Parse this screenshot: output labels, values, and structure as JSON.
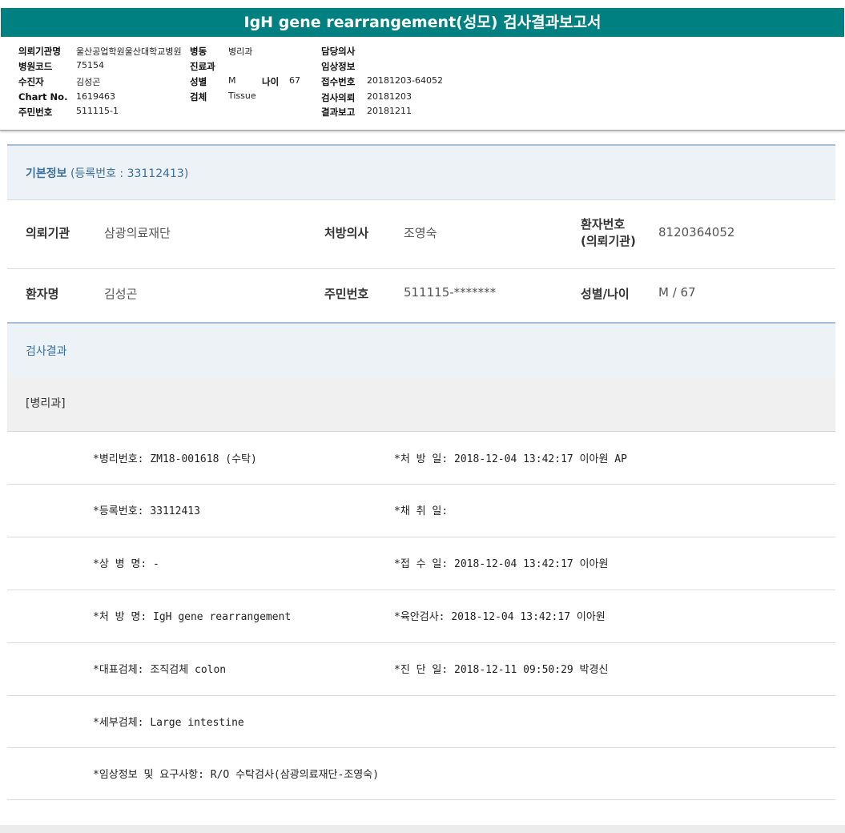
{
  "report_title": "IgH gene rearrangement(성모) 검사결과보고서",
  "header": {
    "left": [
      {
        "label": "의뢰기관명",
        "value": "울산공업학원울산대학교병원"
      },
      {
        "label": "병원코드",
        "value": "75154"
      },
      {
        "label": "수진자",
        "value": "김성곤"
      },
      {
        "label": "Chart No.",
        "value": "1619463"
      },
      {
        "label": "주민번호",
        "value": "511115-1"
      }
    ],
    "middle": {
      "ward_label": "병동",
      "ward_value": "병리과",
      "dept_label": "진료과",
      "sex_label": "성별",
      "sex_value": "M",
      "age_label": "나이",
      "age_value": "67",
      "specimen_label": "검체",
      "specimen_value": "Tissue"
    },
    "right": [
      {
        "label": "담당의사",
        "value": ""
      },
      {
        "label": "임상정보",
        "value": ""
      },
      {
        "label": "접수번호",
        "value": "20181203-64052"
      },
      {
        "label": "검사의뢰",
        "value": "20181203"
      },
      {
        "label": "결과보고",
        "value": "20181211"
      }
    ]
  },
  "basic_info": {
    "title_main": "기본정보",
    "title_sub": "(등록번호 : 33112413)",
    "rows": [
      [
        {
          "label": "의뢰기관",
          "value": "삼광의료재단"
        },
        {
          "label": "처방의사",
          "value": "조영숙"
        },
        {
          "label_line1": "환자번호",
          "label_line2": "(의뢰기관)",
          "value": "8120364052"
        }
      ],
      [
        {
          "label": "환자명",
          "value": "김성곤"
        },
        {
          "label": "주민번호",
          "value": "511115-*******"
        },
        {
          "label": "성별/나이",
          "value": "M / 67"
        }
      ]
    ]
  },
  "results": {
    "title": "검사결과",
    "subheader": "[병리과]",
    "rows": [
      {
        "left": "*병리번호: ZM18-001618 (수탁)",
        "right": "*처 방 일: 2018-12-04 13:42:17  이아원 AP"
      },
      {
        "left": "*등록번호: 33112413",
        "right": "*채 취 일:"
      },
      {
        "left": "*상 병 명: -",
        "right": "*접 수 일: 2018-12-04 13:42:17  이아원"
      },
      {
        "left": "*처 방 명: IgH gene rearrangement",
        "right": "*육안검사: 2018-12-04 13:42:17  이아원"
      },
      {
        "left": "*대표검체: 조직검체 colon",
        "right": "*진 단 일: 2018-12-11 09:50:29  박경신"
      },
      {
        "left": "*세부검체: Large intestine",
        "right": ""
      },
      {
        "left": "*임상정보 및 요구사항: R/O 수탁검사(삼광의료재단-조영숙)",
        "right": ""
      }
    ]
  }
}
